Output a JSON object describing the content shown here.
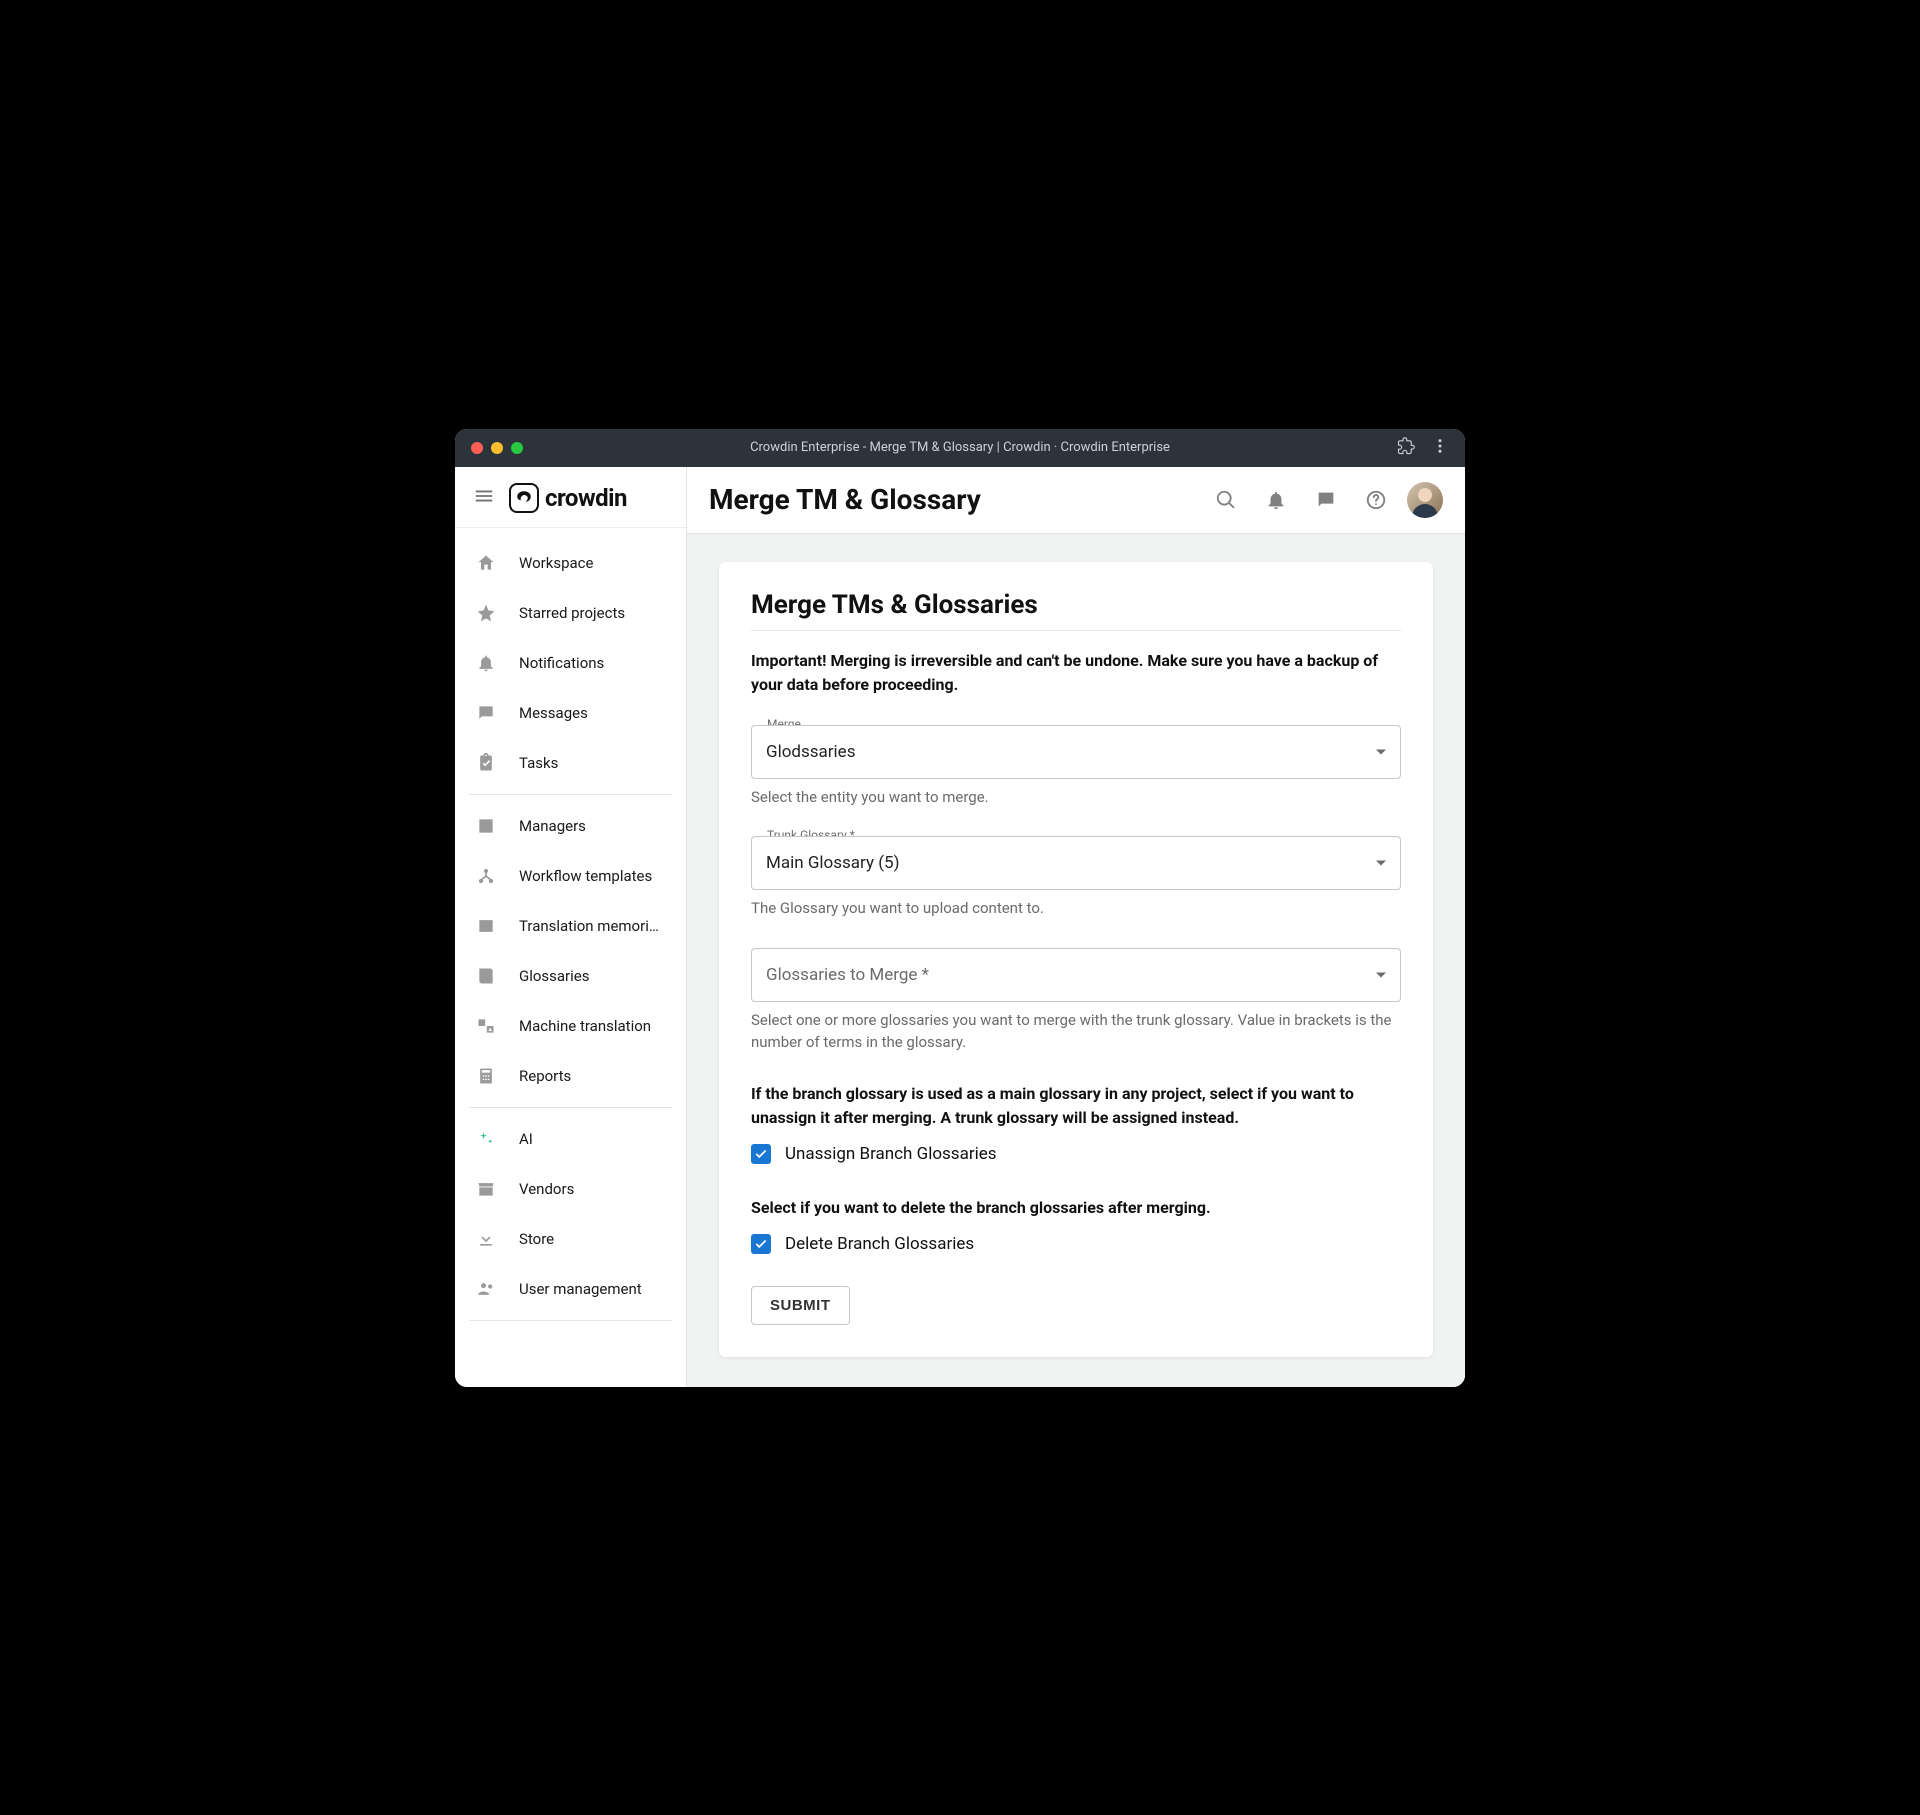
{
  "window": {
    "title": "Crowdin Enterprise - Merge TM & Glossary | Crowdin · Crowdin Enterprise"
  },
  "logo": {
    "text": "crowdin"
  },
  "header": {
    "page_title": "Merge TM & Glossary"
  },
  "sidebar": {
    "items": [
      {
        "label": "Workspace"
      },
      {
        "label": "Starred projects"
      },
      {
        "label": "Notifications"
      },
      {
        "label": "Messages"
      },
      {
        "label": "Tasks"
      },
      {
        "label": "Managers"
      },
      {
        "label": "Workflow templates"
      },
      {
        "label": "Translation memori…"
      },
      {
        "label": "Glossaries"
      },
      {
        "label": "Machine translation"
      },
      {
        "label": "Reports"
      },
      {
        "label": "AI"
      },
      {
        "label": "Vendors"
      },
      {
        "label": "Store"
      },
      {
        "label": "User management"
      }
    ]
  },
  "card": {
    "title": "Merge TMs & Glossaries",
    "warning": "Important! Merging is irreversible and can't be undone. Make sure you have a backup of your data before proceeding.",
    "merge_field": {
      "label": "Merge",
      "value": "Glodssaries",
      "helper": "Select the entity you want to merge."
    },
    "trunk_field": {
      "label": "Trunk Glossary *",
      "value": "Main Glossary (5)",
      "helper": "The Glossary you want to upload content to."
    },
    "to_merge_field": {
      "placeholder": "Glossaries to Merge *",
      "helper": "Select one or more glossaries you want to merge with the trunk glossary. Value in brackets is the number of terms in the glossary."
    },
    "unassign": {
      "text": "If the branch glossary is used as a main glossary in any project, select if you want to unassign it after merging. A trunk glossary will be assigned instead.",
      "checkbox_label": "Unassign Branch Glossaries"
    },
    "delete": {
      "text": "Select if you want to delete the branch glossaries after merging.",
      "checkbox_label": "Delete Branch Glossaries"
    },
    "submit_label": "SUBMIT"
  }
}
